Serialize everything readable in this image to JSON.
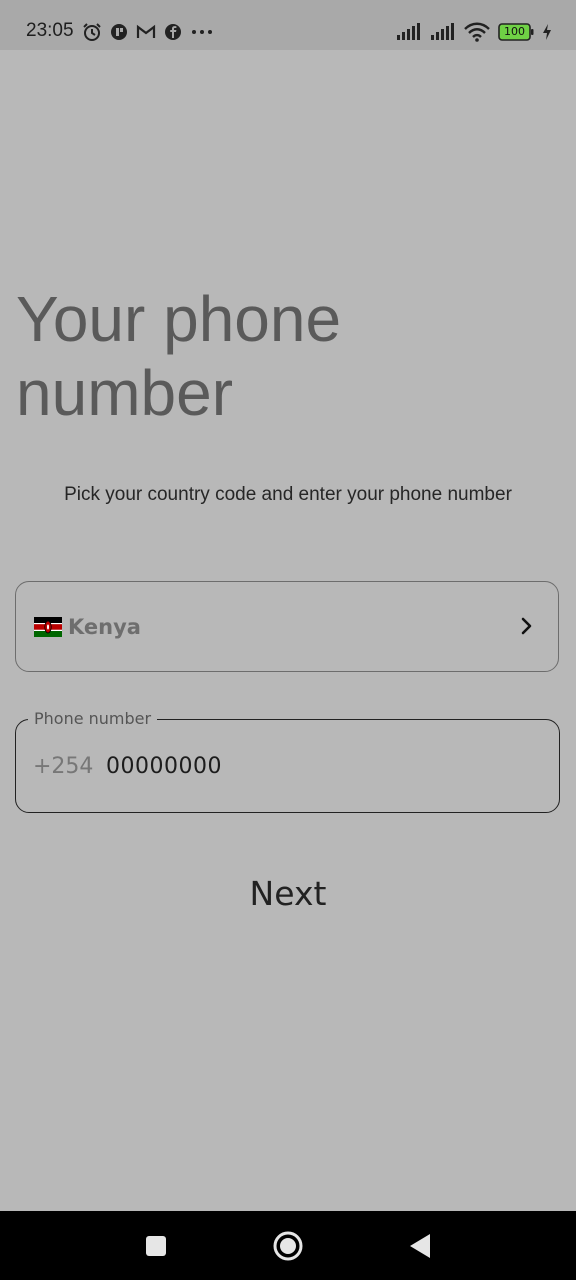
{
  "status_bar": {
    "time": "23:05",
    "battery": "100",
    "icons_left": [
      "alarm-icon",
      "app-icon",
      "gmail-icon",
      "facebook-icon",
      "more-icon"
    ],
    "icons_right": [
      "signal-icon",
      "signal-icon",
      "wifi-icon",
      "battery-icon",
      "charging-icon"
    ]
  },
  "screen": {
    "title": "Your phone number",
    "subtitle": "Pick your country code and enter your phone number"
  },
  "country_selector": {
    "flag": "kenya-flag-icon",
    "country": "Kenya"
  },
  "phone_field": {
    "label": "Phone number",
    "prefix": "+254",
    "value": "00000000"
  },
  "next_button": {
    "label": "Next"
  },
  "nav_bar": {
    "buttons": [
      "recents",
      "home",
      "back"
    ]
  },
  "colors": {
    "background": "#b8b8b8",
    "status_bar": "#a9a9a9",
    "title": "#5a5a5a",
    "nav_bar": "#000000",
    "battery_fill": "#6fd145"
  }
}
